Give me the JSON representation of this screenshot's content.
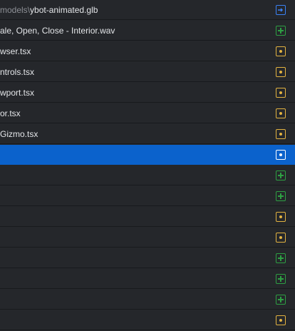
{
  "colors": {
    "background": "#25272b",
    "selected_row": "#0b62cc",
    "added": "#2ea043",
    "modified": "#e3b341",
    "renamed": "#3b82f6"
  },
  "rows": [
    {
      "dir": "models\\",
      "file": "ybot-animated.glb",
      "status": "renamed",
      "icon": "arrow-into-box-icon"
    },
    {
      "dir": "",
      "file": "ale, Open, Close - Interior.wav",
      "status": "added",
      "icon": "plus-square-icon"
    },
    {
      "dir": "",
      "file": "wser.tsx",
      "status": "modified",
      "icon": "dot-square-icon"
    },
    {
      "dir": "",
      "file": "ntrols.tsx",
      "status": "modified",
      "icon": "dot-square-icon"
    },
    {
      "dir": "",
      "file": "wport.tsx",
      "status": "modified",
      "icon": "dot-square-icon"
    },
    {
      "dir": "",
      "file": "or.tsx",
      "status": "modified",
      "icon": "dot-square-icon"
    },
    {
      "dir": "",
      "file": "Gizmo.tsx",
      "status": "modified",
      "icon": "dot-square-icon"
    },
    {
      "dir": "",
      "file": "",
      "status": "modified",
      "icon": "dot-square-icon",
      "selected": true
    },
    {
      "dir": "",
      "file": "",
      "status": "added",
      "icon": "plus-square-icon"
    },
    {
      "dir": "",
      "file": "",
      "status": "added",
      "icon": "plus-square-icon"
    },
    {
      "dir": "",
      "file": "",
      "status": "modified",
      "icon": "dot-square-icon"
    },
    {
      "dir": "",
      "file": "",
      "status": "modified",
      "icon": "dot-square-icon"
    },
    {
      "dir": "",
      "file": "",
      "status": "added",
      "icon": "plus-square-icon"
    },
    {
      "dir": "",
      "file": "",
      "status": "added",
      "icon": "plus-square-icon"
    },
    {
      "dir": "",
      "file": "",
      "status": "added",
      "icon": "plus-square-icon"
    },
    {
      "dir": "",
      "file": "",
      "status": "modified",
      "icon": "dot-square-icon"
    }
  ]
}
